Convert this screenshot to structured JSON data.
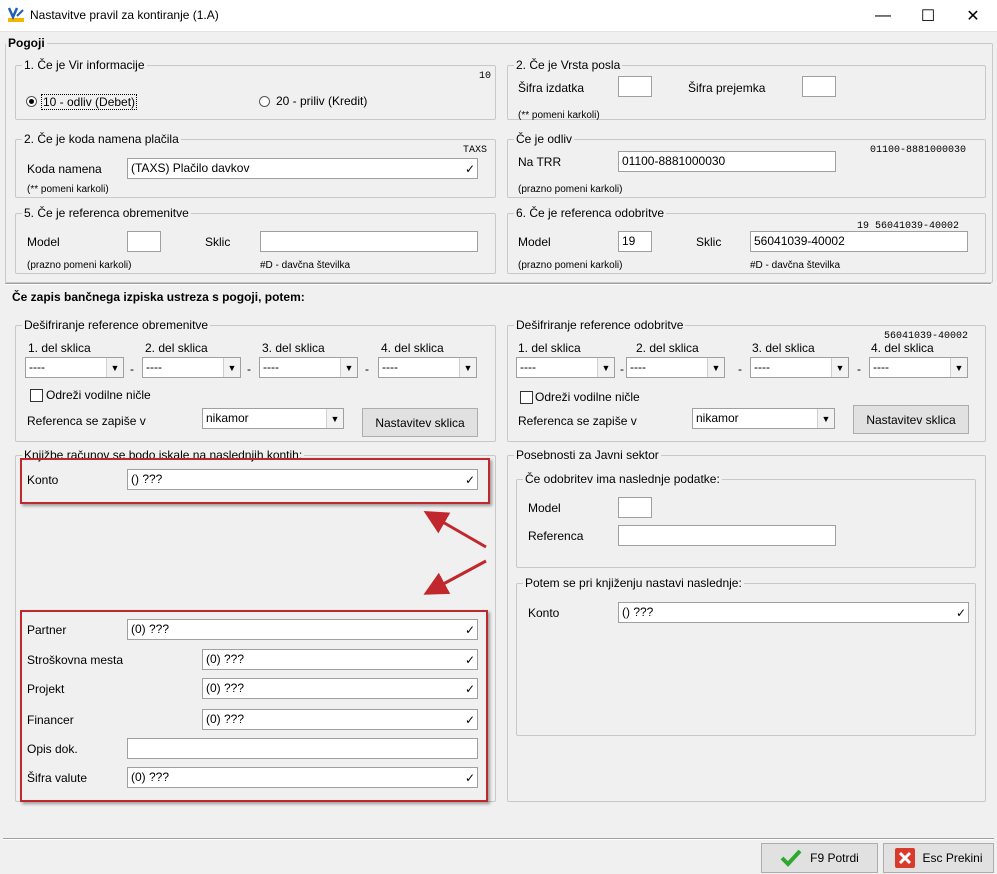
{
  "window": {
    "title": "Nastavitve pravil za kontiranje  (1.A)",
    "min": "—",
    "max": "☐",
    "close": "✕"
  },
  "pogoji": {
    "title": "Pogoji",
    "vir": {
      "title": "1. Če je Vir informacije",
      "code": "10",
      "opt1": "10 - odliv (Debet)",
      "opt2": "20 - priliv (Kredit)"
    },
    "vrsta": {
      "title": "2. Če je Vrsta posla",
      "izdatek_label": "Šifra izdatka",
      "izdatek_value": "",
      "prejemek_label": "Šifra prejemka",
      "prejemek_value": "",
      "note": "(** pomeni karkoli)"
    },
    "namen": {
      "title": "2. Če je koda namena plačila",
      "code": "TAXS",
      "label": "Koda namena",
      "value": "(TAXS) Plačilo davkov",
      "note": "(** pomeni karkoli)"
    },
    "odliv": {
      "title": "Če je odliv",
      "code": "01100-8881000030",
      "label": "Na TRR",
      "value": "01100-8881000030",
      "note": "(prazno pomeni karkoli)"
    },
    "obrem": {
      "title": "5. Če je referenca obremenitve",
      "model_label": "Model",
      "model_value": "",
      "sklic_label": "Sklic",
      "sklic_value": "",
      "note": "(prazno pomeni karkoli)",
      "note2": "#D - davčna številka"
    },
    "odobr": {
      "title": "6. Če je referenca odobritve",
      "code": "19  56041039-40002",
      "model_label": "Model",
      "model_value": "19",
      "sklic_label": "Sklic",
      "sklic_value": "56041039-40002",
      "note": "(prazno pomeni karkoli)",
      "note2": "#D - davčna številka"
    }
  },
  "potem": {
    "title": "Če zapis bančnega izpiska ustreza s pogoji, potem:",
    "desif_obr": {
      "title": "Dešifriranje reference obremenitve",
      "d1": "1. del sklica",
      "d2": "2. del sklica",
      "d3": "3. del sklica",
      "d4": "4. del sklica",
      "dash": "----",
      "sep": "-",
      "chk": "Odreži vodilne ničle",
      "ref_label": "Referenca se zapiše v",
      "ref_value": "nikamor",
      "btn": "Nastavitev sklica"
    },
    "desif_odb": {
      "title": "Dešifriranje reference odobritve",
      "code": "56041039-40002",
      "d1": "1. del sklica",
      "d2": "2. del sklica",
      "d3": "3. del sklica",
      "d4": "4. del sklica",
      "dash": "----",
      "sep": "-",
      "chk": "Odreži vodilne ničle",
      "ref_label": "Referenca se zapiše v",
      "ref_value": "nikamor",
      "btn": "Nastavitev sklica"
    },
    "knjizbe": {
      "title": "Knjižbe računov se bodo iskale na naslednjih kontih:",
      "konto_label": "Konto",
      "konto_value": "() ???",
      "partner_label": "Partner",
      "partner_value": "(0) ???",
      "strm_label": "Stroškovna mesta",
      "strm_value": "(0) ???",
      "projekt_label": "Projekt",
      "projekt_value": "(0) ???",
      "financer_label": "Financer",
      "financer_value": "(0) ???",
      "opis_label": "Opis dok.",
      "opis_value": "",
      "valuta_label": "Šifra valute",
      "valuta_value": "(0) ???"
    },
    "javni": {
      "title": "Posebnosti za Javni sektor",
      "odobr_title": "Če odobritev ima naslednje podatke:",
      "model_label": "Model",
      "model_value": "",
      "ref_label": "Referenca",
      "ref_value": "",
      "potem_title": "Potem se pri knjiženju nastavi naslednje:",
      "konto_label": "Konto",
      "konto_value": "() ???"
    }
  },
  "footer": {
    "ok": "F9 Potrdi",
    "cancel": "Esc Prekini"
  },
  "colors": {
    "highlight": "#c0282d"
  }
}
